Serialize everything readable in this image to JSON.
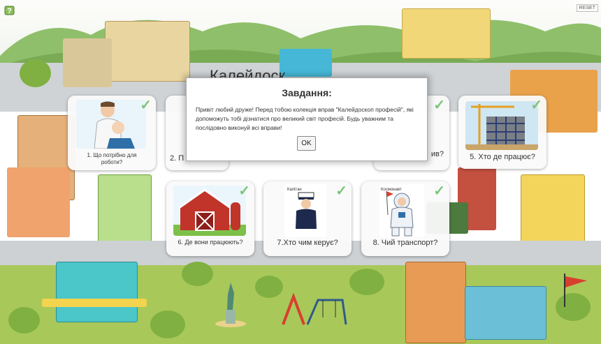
{
  "toolbar": {
    "help_icon": "help-question-icon",
    "reset_label": "RESET"
  },
  "background_title_fragment": "Калейдоск",
  "dialog": {
    "title": "Завдання:",
    "text": "Привіт любий друже! Перед тобою колекція вправ \"Калейдоскоп професій\", які допоможуть тобі дізнатися про великий світ професій. Будь уважним та послідовно виконуй всі вправи!",
    "ok_label": "OK"
  },
  "tiles": [
    {
      "caption": "1. Що потрібно для роботи?",
      "image": "dentist-with-child",
      "completed": true
    },
    {
      "caption": "2. П",
      "image": "hidden",
      "completed": true
    },
    {
      "caption": "ив?",
      "image": "hidden",
      "completed": true
    },
    {
      "caption": "5. Хто де працює?",
      "image": "construction-site",
      "completed": true
    },
    {
      "caption": "6. Де вони працюють?",
      "image": "red-barn",
      "completed": true
    },
    {
      "caption": "7.Хто чим керує?",
      "image": "captain",
      "completed": true
    },
    {
      "caption": "8. Чий транспорт?",
      "image": "cosmonaut",
      "completed": true
    }
  ],
  "picture_labels": {
    "captain": "Капітан",
    "cosmonaut": "Космонавт"
  },
  "colors": {
    "check": "#7cc47a",
    "tile_bg": "#fafafa",
    "grass": "#a9c85a",
    "road": "#cfd3d6"
  }
}
